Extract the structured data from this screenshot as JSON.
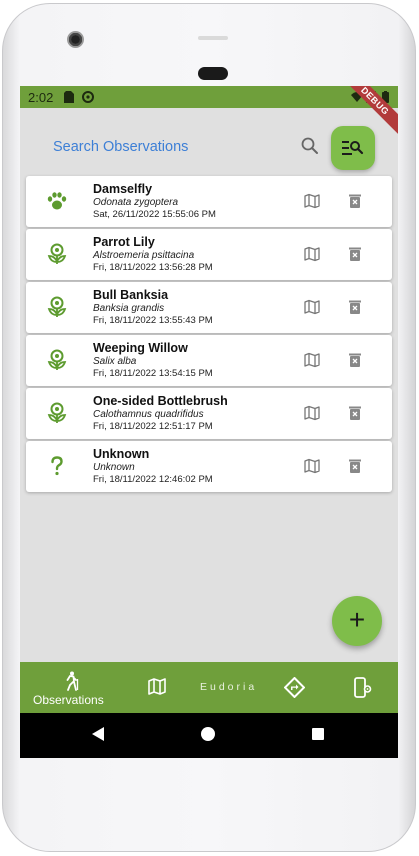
{
  "status_bar": {
    "time": "2:02",
    "debug_label": "DEBUG"
  },
  "search": {
    "placeholder": "Search Observations"
  },
  "observations": [
    {
      "name": "Damselfly",
      "scientific": "Odonata zygoptera",
      "date": "Sat, 26/11/2022 15:55:06 PM",
      "icon": "paw-icon"
    },
    {
      "name": "Parrot Lily",
      "scientific": "Alstroemeria psittacina",
      "date": "Fri, 18/11/2022 13:56:28 PM",
      "icon": "flower-icon"
    },
    {
      "name": "Bull Banksia",
      "scientific": "Banksia grandis",
      "date": "Fri, 18/11/2022 13:55:43 PM",
      "icon": "flower-icon"
    },
    {
      "name": "Weeping Willow",
      "scientific": "Salix alba",
      "date": "Fri, 18/11/2022 13:54:15 PM",
      "icon": "flower-icon"
    },
    {
      "name": "One-sided Bottlebrush",
      "scientific": "Calothamnus quadrifidus",
      "date": "Fri, 18/11/2022 12:51:17 PM",
      "icon": "flower-icon"
    },
    {
      "name": "Unknown",
      "scientific": "Unknown",
      "date": "Fri, 18/11/2022 12:46:02 PM",
      "icon": "question-icon"
    }
  ],
  "fab": {
    "label": "+"
  },
  "bottom_nav": {
    "observations_label": "Observations",
    "brand": "Eudoria"
  },
  "colors": {
    "accent": "#7fbd4a",
    "bar": "#6f9f3b",
    "link": "#3d7fd6"
  }
}
